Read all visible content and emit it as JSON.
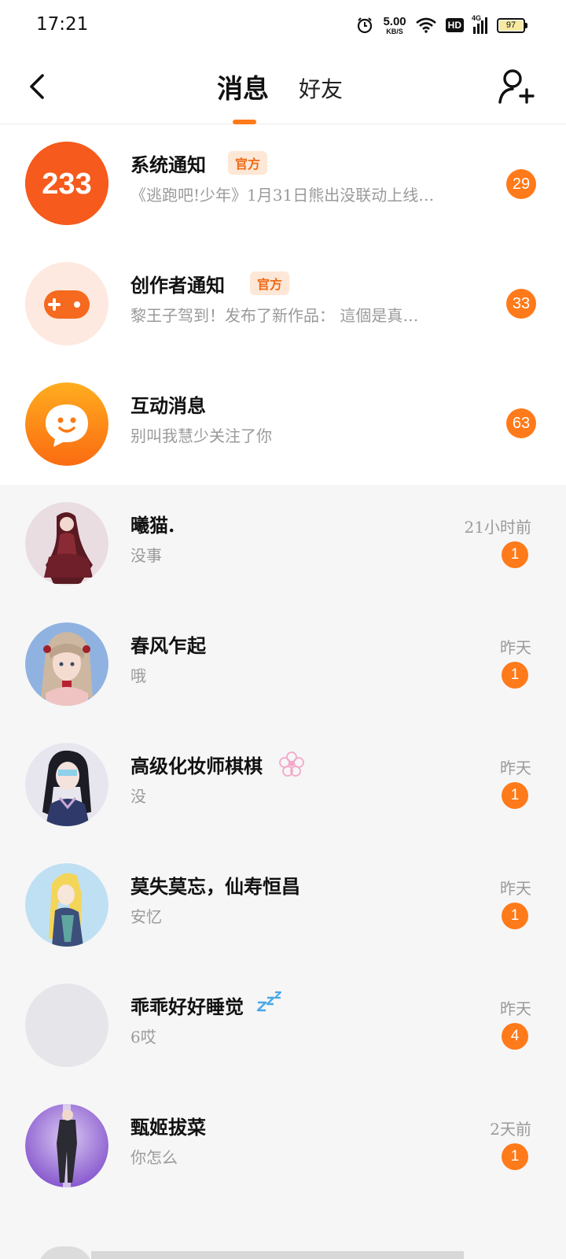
{
  "status_bar": {
    "time": "17:21",
    "net_speed": "5.00",
    "net_unit": "KB/S",
    "hd": "HD",
    "network": "4G",
    "battery": "97"
  },
  "header": {
    "tab_messages": "消息",
    "tab_friends": "好友",
    "active_tab": "消息",
    "accent_color": "#ff7a1a"
  },
  "system_items": [
    {
      "title": "系统通知",
      "tag": "官方",
      "subtitle": "《逃跑吧!少年》1月31日熊出没联动上线…",
      "count": "29",
      "icon": "233-logo-icon",
      "icon_text": "233"
    },
    {
      "title": "创作者通知",
      "tag": "官方",
      "subtitle": "黎王子驾到！发布了新作品： 這個是真…",
      "count": "33",
      "icon": "gamepad-icon"
    },
    {
      "title": "互动消息",
      "tag": "",
      "subtitle": "别叫我慧少关注了你",
      "count": "63",
      "icon": "chat-bubble-icon"
    }
  ],
  "conversations": [
    {
      "name": "曦猫.",
      "message": "没事",
      "time": "21小时前",
      "unread": "1"
    },
    {
      "name": "春风乍起",
      "message": "哦",
      "time": "昨天",
      "unread": "1"
    },
    {
      "name": "高级化妆师棋棋",
      "message": "没",
      "time": "昨天",
      "unread": "1"
    },
    {
      "name": "莫失莫忘，仙寿恒昌",
      "message": "安忆",
      "time": "昨天",
      "unread": "1"
    },
    {
      "name": "乖乖好好睡觉",
      "message": "6哎",
      "time": "昨天",
      "unread": "4"
    },
    {
      "name": "甄姬拔菜",
      "message": "你怎么",
      "time": "2天前",
      "unread": "1"
    }
  ]
}
